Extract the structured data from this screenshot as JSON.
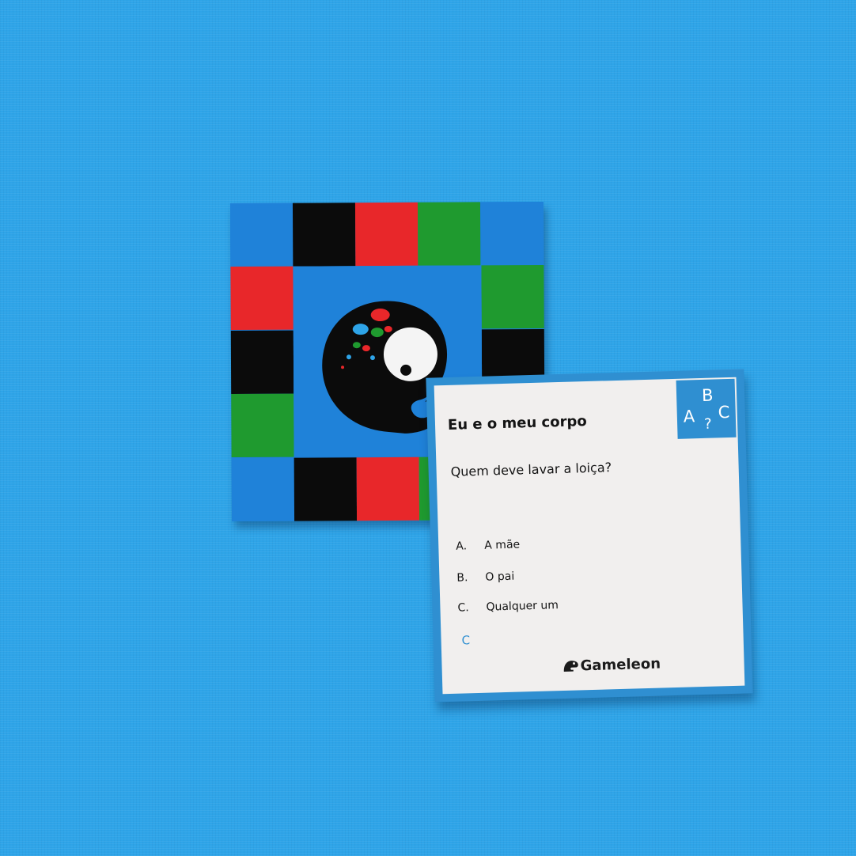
{
  "card": {
    "title": "Eu e o meu corpo",
    "badge": {
      "a": "A",
      "b": "B",
      "c": "C",
      "q": "?"
    },
    "question": "Quem deve lavar a loiça?",
    "options": [
      {
        "letter": "A.",
        "text": "A mãe"
      },
      {
        "letter": "B.",
        "text": "O pai"
      },
      {
        "letter": "C.",
        "text": "Qualquer um"
      }
    ],
    "answer": "C",
    "brand": "Gameleon"
  },
  "colors": {
    "background": "#2ea4e8",
    "blue": "#1f82d9",
    "black": "#0b0b0b",
    "red": "#e8272a",
    "green": "#1f9a2f",
    "card_accent": "#2f8fd1"
  }
}
